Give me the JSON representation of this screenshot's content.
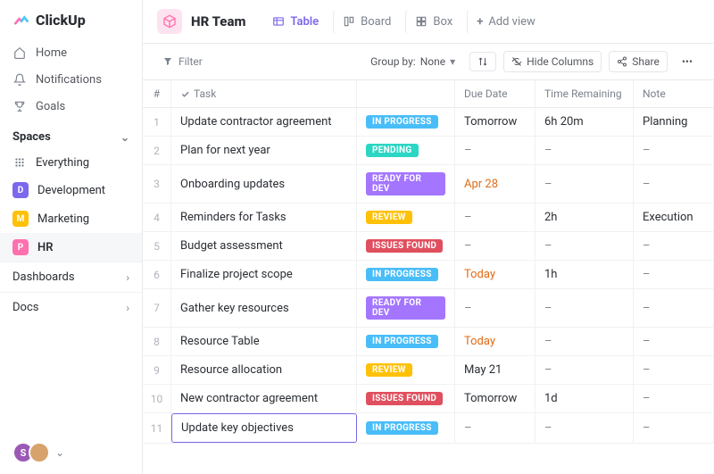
{
  "brand": "ClickUp",
  "nav": {
    "home": "Home",
    "notifications": "Notifications",
    "goals": "Goals"
  },
  "spaces": {
    "header": "Spaces",
    "everything": "Everything",
    "items": [
      {
        "label": "Development",
        "letter": "D",
        "color": "#7b68ee"
      },
      {
        "label": "Marketing",
        "letter": "M",
        "color": "#ffc107"
      },
      {
        "label": "HR",
        "letter": "P",
        "color": "#fd71af"
      }
    ]
  },
  "sections": {
    "dashboards": "Dashboards",
    "docs": "Docs"
  },
  "header": {
    "space_title": "HR Team",
    "views": {
      "table": "Table",
      "board": "Board",
      "box": "Box",
      "add": "Add view"
    }
  },
  "filterbar": {
    "filter": "Filter",
    "groupby_label": "Group by:",
    "groupby_value": "None",
    "hide_columns": "Hide Columns",
    "share": "Share"
  },
  "columns": {
    "idx": "#",
    "task": "Task",
    "due": "Due Date",
    "time": "Time Remaining",
    "note": "Note"
  },
  "status_colors": {
    "IN PROGRESS": "#49bdf8",
    "PENDING": "#2bd6c4",
    "READY FOR DEV": "#a476ff",
    "REVIEW": "#ffc107",
    "ISSUES FOUND": "#e04f5f"
  },
  "rows": [
    {
      "idx": "1",
      "task": "Update contractor agreement",
      "status": "IN PROGRESS",
      "due": "Tomorrow",
      "time": "6h 20m",
      "note": "Planning"
    },
    {
      "idx": "2",
      "task": "Plan for next year",
      "status": "PENDING",
      "due": "–",
      "time": "–",
      "note": "–"
    },
    {
      "idx": "3",
      "task": "Onboarding updates",
      "status": "READY FOR DEV",
      "due": "Apr 28",
      "due_color": "orange",
      "time": "–",
      "note": "–"
    },
    {
      "idx": "4",
      "task": "Reminders for Tasks",
      "status": "REVIEW",
      "due": "–",
      "time": "2h",
      "note": "Execution"
    },
    {
      "idx": "5",
      "task": "Budget assessment",
      "status": "ISSUES FOUND",
      "due": "–",
      "time": "–",
      "note": "–"
    },
    {
      "idx": "6",
      "task": "Finalize project scope",
      "status": "IN PROGRESS",
      "due": "Today",
      "due_color": "orange",
      "time": "1h",
      "note": "–"
    },
    {
      "idx": "7",
      "task": "Gather key resources",
      "status": "READY FOR DEV",
      "due": "–",
      "time": "–",
      "note": "–"
    },
    {
      "idx": "8",
      "task": "Resource Table",
      "status": "IN PROGRESS",
      "due": "Today",
      "due_color": "orange",
      "time": "–",
      "note": "–"
    },
    {
      "idx": "9",
      "task": "Resource allocation",
      "status": "REVIEW",
      "due": "May 21",
      "time": "–",
      "note": "–"
    },
    {
      "idx": "10",
      "task": "New contractor agreement",
      "status": "ISSUES FOUND",
      "due": "Tomorrow",
      "time": "1d",
      "note": "–"
    },
    {
      "idx": "11",
      "task": "Update key objectives",
      "status": "IN PROGRESS",
      "due": "–",
      "time": "–",
      "note": "–",
      "editing": true
    }
  ]
}
